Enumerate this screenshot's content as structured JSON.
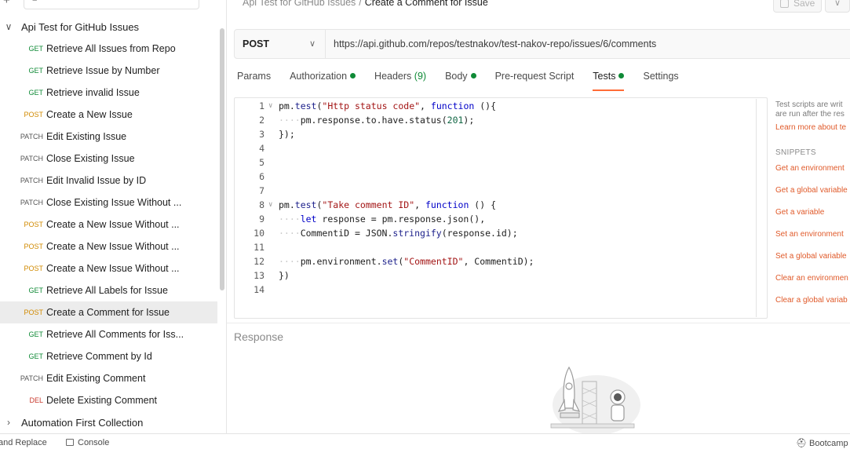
{
  "sidebar": {
    "more_icon": "···",
    "collection": {
      "name": "Api Test for GitHub Issues",
      "expanded": true
    },
    "requests": [
      {
        "method": "GET",
        "name": "Retrieve All Issues from Repo"
      },
      {
        "method": "GET",
        "name": "Retrieve Issue by Number"
      },
      {
        "method": "GET",
        "name": "Retrieve invalid Issue"
      },
      {
        "method": "POST",
        "name": "Create a New Issue"
      },
      {
        "method": "PATCH",
        "name": "Edit Existing Issue"
      },
      {
        "method": "PATCH",
        "name": "Close Existing Issue"
      },
      {
        "method": "PATCH",
        "name": "Edit Invalid Issue by ID"
      },
      {
        "method": "PATCH",
        "name": "Close Existing Issue Without ..."
      },
      {
        "method": "POST",
        "name": "Create a New Issue Without ..."
      },
      {
        "method": "POST",
        "name": "Create a New Issue Without ..."
      },
      {
        "method": "POST",
        "name": "Create a New Issue Without ..."
      },
      {
        "method": "GET",
        "name": "Retrieve All Labels for Issue"
      },
      {
        "method": "POST",
        "name": "Create a Comment for Issue",
        "selected": true
      },
      {
        "method": "GET",
        "name": "Retrieve All Comments for Iss..."
      },
      {
        "method": "GET",
        "name": "Retrieve Comment by Id"
      },
      {
        "method": "PATCH",
        "name": "Edit Existing Comment"
      },
      {
        "method": "DEL",
        "name": "Delete Existing Comment"
      }
    ],
    "collection2": {
      "name": "Automation First Collection",
      "expanded": false
    }
  },
  "breadcrumb": {
    "parent": "Api Test for GitHub Issues",
    "separator": "/",
    "current": "Create a Comment for Issue"
  },
  "toolbar": {
    "save_label": "Save"
  },
  "request": {
    "method": "POST",
    "url": "https://api.github.com/repos/testnakov/test-nakov-repo/issues/6/comments"
  },
  "tabs": [
    {
      "label": "Params"
    },
    {
      "label": "Authorization",
      "dot": true
    },
    {
      "label": "Headers",
      "count": "(9)"
    },
    {
      "label": "Body",
      "dot": true
    },
    {
      "label": "Pre-request Script"
    },
    {
      "label": "Tests",
      "dot": true,
      "active": true
    },
    {
      "label": "Settings"
    }
  ],
  "editor": {
    "lines": [
      {
        "n": "1",
        "fold": true,
        "code": "pm.test(\"Http status code\", function (){"
      },
      {
        "n": "2",
        "fold": false,
        "code": "····pm.response.to.have.status(201);"
      },
      {
        "n": "3",
        "fold": false,
        "code": "});"
      },
      {
        "n": "4",
        "fold": false,
        "code": ""
      },
      {
        "n": "5",
        "fold": false,
        "code": ""
      },
      {
        "n": "6",
        "fold": false,
        "code": ""
      },
      {
        "n": "7",
        "fold": false,
        "code": ""
      },
      {
        "n": "8",
        "fold": true,
        "code": "pm.test(\"Take comment ID\", function () {"
      },
      {
        "n": "9",
        "fold": false,
        "code": "····let response = pm.response.json(),"
      },
      {
        "n": "10",
        "fold": false,
        "code": "····CommentiD = JSON.stringify(response.id);"
      },
      {
        "n": "11",
        "fold": false,
        "code": ""
      },
      {
        "n": "12",
        "fold": false,
        "code": "····pm.environment.set(\"CommentID\", CommentiD);"
      },
      {
        "n": "13",
        "fold": false,
        "code": "})"
      },
      {
        "n": "14",
        "fold": false,
        "code": ""
      }
    ]
  },
  "snippets_panel": {
    "description": "Test scripts are writ are run after the res",
    "learn_more": "Learn more about te",
    "title": "SNIPPETS",
    "items": [
      "Get an environment",
      "Get a global variable",
      "Get a variable",
      "Set an environment",
      "Set a global variable",
      "Clear an environmen",
      "Clear a global variab"
    ]
  },
  "response": {
    "title": "Response"
  },
  "statusbar": {
    "find_replace": "and Replace",
    "console": "Console",
    "bootcamp": "Bootcamp"
  }
}
